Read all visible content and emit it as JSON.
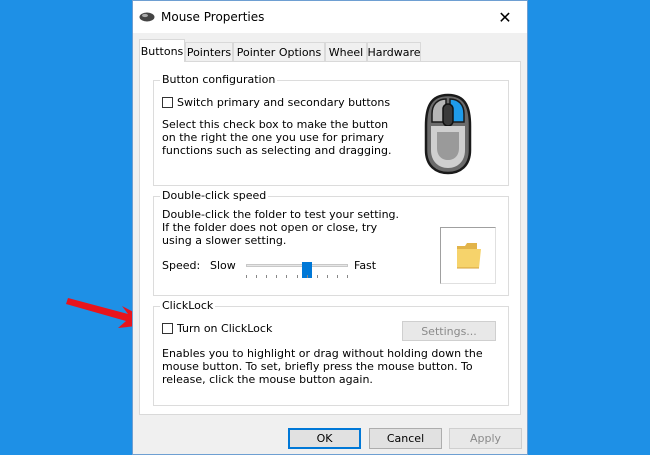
{
  "window": {
    "title": "Mouse Properties",
    "close_glyph": "✕"
  },
  "tabs": [
    {
      "label": "Buttons",
      "active": true
    },
    {
      "label": "Pointers",
      "active": false
    },
    {
      "label": "Pointer Options",
      "active": false
    },
    {
      "label": "Wheel",
      "active": false
    },
    {
      "label": "Hardware",
      "active": false
    }
  ],
  "button_config": {
    "legend": "Button configuration",
    "checkbox_label": "Switch primary and secondary buttons",
    "checked": false,
    "description": "Select this check box to make the button on the right the one you use for primary functions such as selecting and dragging."
  },
  "double_click": {
    "legend": "Double-click speed",
    "description": "Double-click the folder to test your setting. If the folder does not open or close, try using a slower setting.",
    "speed_label": "Speed:",
    "slow_label": "Slow",
    "fast_label": "Fast",
    "slider_value_fraction": 0.6
  },
  "clicklock": {
    "legend": "ClickLock",
    "checkbox_label": "Turn on ClickLock",
    "checked": false,
    "settings_label": "Settings...",
    "description": "Enables you to highlight or drag without holding down the mouse button. To set, briefly press the mouse button. To release, click the mouse button again."
  },
  "footer": {
    "ok_label": "OK",
    "cancel_label": "Cancel",
    "apply_label": "Apply"
  },
  "colors": {
    "desktop": "#1e90e6",
    "accent": "#0078d7",
    "arrow": "#e8141c"
  }
}
